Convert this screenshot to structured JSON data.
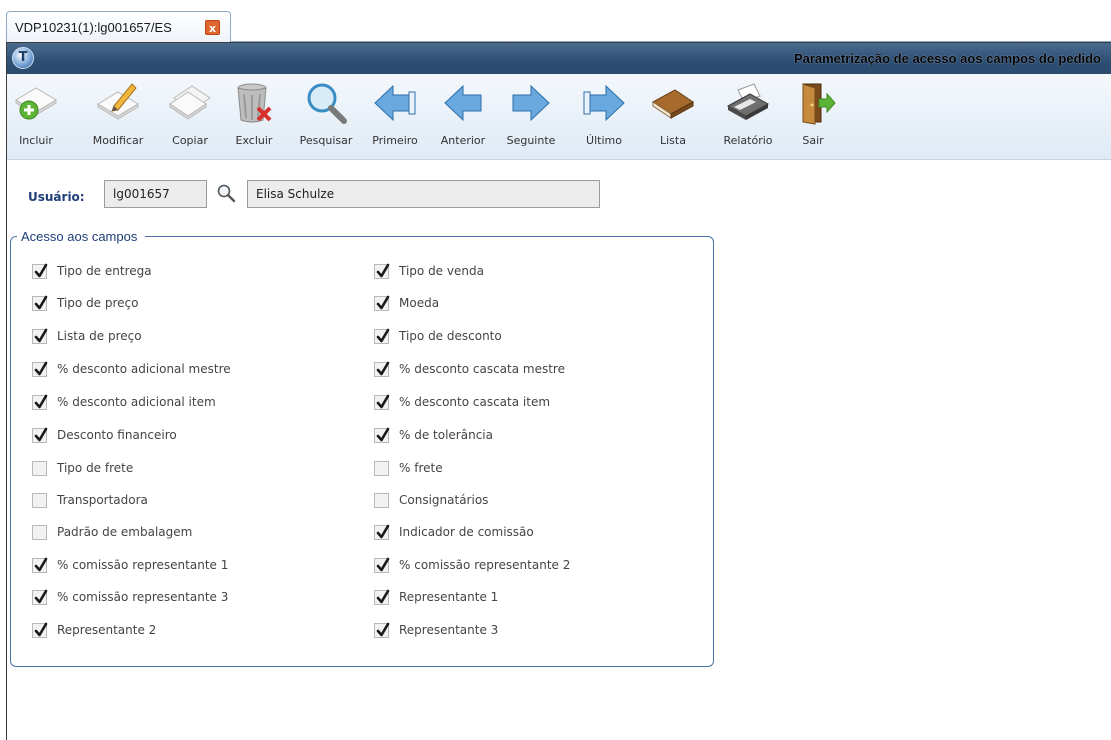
{
  "tab": {
    "label": "VDP10231(1):lg001657/ES",
    "close_glyph": "x"
  },
  "window": {
    "title": "Parametrização de acesso aos campos do pedido",
    "logo_glyph": "T"
  },
  "toolbar": [
    {
      "label": "Incluir",
      "icon": "add-icon"
    },
    {
      "label": "Modificar",
      "icon": "edit-icon"
    },
    {
      "label": "Copiar",
      "icon": "copy-icon"
    },
    {
      "label": "Excluir",
      "icon": "delete-icon"
    },
    {
      "label": "Pesquisar",
      "icon": "search-icon"
    },
    {
      "label": "Primeiro",
      "icon": "first-icon"
    },
    {
      "label": "Anterior",
      "icon": "previous-icon"
    },
    {
      "label": "Seguinte",
      "icon": "next-icon"
    },
    {
      "label": "Último",
      "icon": "last-icon"
    },
    {
      "label": "Lista",
      "icon": "list-icon"
    },
    {
      "label": "Relatório",
      "icon": "report-icon"
    },
    {
      "label": "Sair",
      "icon": "exit-icon"
    }
  ],
  "user": {
    "label": "Usuário:",
    "code": "lg001657",
    "name": "Elisa Schulze"
  },
  "group": {
    "legend": "Acesso aos campos",
    "left": [
      {
        "label": "Tipo de entrega",
        "checked": true
      },
      {
        "label": "Tipo de preço",
        "checked": true
      },
      {
        "label": "Lista de preço",
        "checked": true
      },
      {
        "label": "% desconto adicional mestre",
        "checked": true
      },
      {
        "label": "% desconto adicional item",
        "checked": true
      },
      {
        "label": "Desconto financeiro",
        "checked": true
      },
      {
        "label": "Tipo de frete",
        "checked": false
      },
      {
        "label": "Transportadora",
        "checked": false
      },
      {
        "label": "Padrão de embalagem",
        "checked": false
      },
      {
        "label": "% comissão representante 1",
        "checked": true
      },
      {
        "label": "% comissão representante 3",
        "checked": true
      },
      {
        "label": "Representante 2",
        "checked": true
      }
    ],
    "right": [
      {
        "label": "Tipo de venda",
        "checked": true
      },
      {
        "label": "Moeda",
        "checked": true
      },
      {
        "label": "Tipo de desconto",
        "checked": true
      },
      {
        "label": "% desconto cascata mestre",
        "checked": true
      },
      {
        "label": "% desconto cascata item",
        "checked": true
      },
      {
        "label": "% de tolerância",
        "checked": true
      },
      {
        "label": "% frete",
        "checked": false
      },
      {
        "label": "Consignatários",
        "checked": false
      },
      {
        "label": "Indicador de comissão",
        "checked": true
      },
      {
        "label": "% comissão representante 2",
        "checked": true
      },
      {
        "label": "Representante 1",
        "checked": true
      },
      {
        "label": "Representante 3",
        "checked": true
      }
    ]
  },
  "colors": {
    "titlebar": "#2e4f74",
    "accent_text": "#1f3e7a",
    "close": "#e0662e"
  }
}
